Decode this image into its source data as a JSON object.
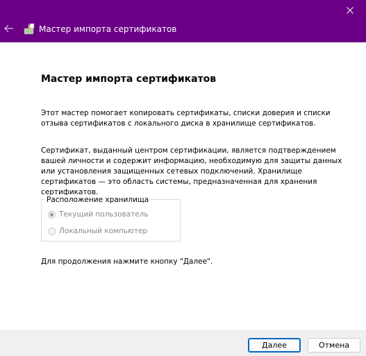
{
  "window": {
    "title": "Мастер импорта сертификатов",
    "titlebar_color": "#6b0086",
    "close_icon": "close-icon",
    "back_icon": "back-arrow-icon",
    "app_icon": "certificate-wizard-icon"
  },
  "content": {
    "heading": "Мастер импорта сертификатов",
    "paragraph1": "Этот мастер помогает копировать сертификаты, списки доверия и списки отзыва сертификатов с локального диска в хранилище сертификатов.",
    "paragraph2": "Сертификат, выданный центром сертификации, является подтверждением вашей личности и содержит информацию, необходимую для защиты данных или установления защищенных сетевых подключений. Хранилище сертификатов — это область системы, предназначенная для хранения сертификатов.",
    "store_location": {
      "legend": "Расположение хранилища",
      "options": [
        {
          "label": "Текущий пользователь",
          "selected": true,
          "disabled": true
        },
        {
          "label": "Локальный компьютер",
          "selected": false,
          "disabled": true
        }
      ]
    },
    "hint": "Для продолжения нажмите кнопку \"Далее\"."
  },
  "footer": {
    "next_label": "Далее",
    "cancel_label": "Отмена",
    "accent_color": "#0067c0"
  }
}
